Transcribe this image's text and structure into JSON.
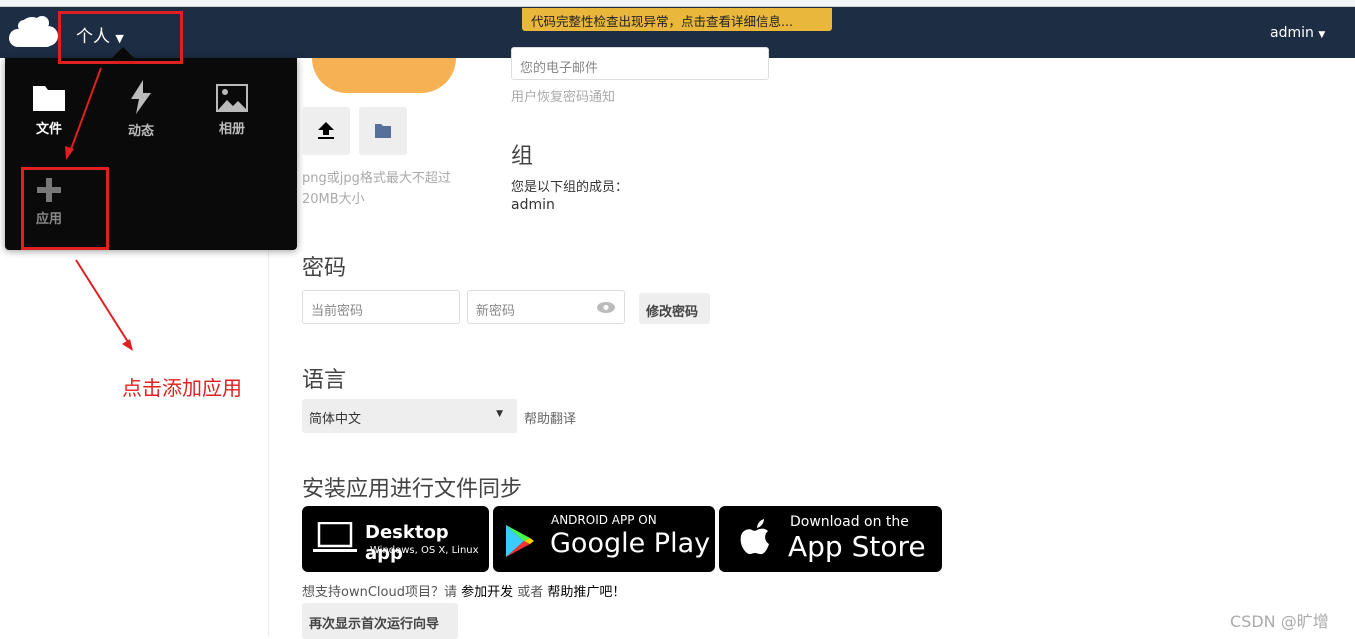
{
  "header": {
    "menu_label": "个人",
    "warning": "代码完整性检查出现异常，点击查看详细信息...",
    "user": "admin"
  },
  "apps_menu": [
    {
      "label": "文件",
      "icon": "folder-icon"
    },
    {
      "label": "动态",
      "icon": "lightning-icon"
    },
    {
      "label": "相册",
      "icon": "image-icon"
    },
    {
      "label": "应用",
      "icon": "plus-icon"
    }
  ],
  "avatar": {
    "hint": "png或jpg格式最大不超过20MB大小"
  },
  "email": {
    "placeholder": "您的电子邮件",
    "hint": "用户恢复密码通知"
  },
  "groups": {
    "title": "组",
    "desc": "您是以下组的成员：",
    "value": "admin"
  },
  "password": {
    "title": "密码",
    "current_placeholder": "当前密码",
    "new_placeholder": "新密码",
    "button": "修改密码"
  },
  "language": {
    "title": "语言",
    "selected": "简体中文",
    "help": "帮助翻译"
  },
  "sync": {
    "title": "安装应用进行文件同步",
    "desktop": {
      "title": "Desktop app",
      "sub": "Windows, OS X, Linux"
    },
    "android": {
      "top": "ANDROID APP ON",
      "main": "Google Play"
    },
    "ios": {
      "top": "Download on the",
      "main": "App Store"
    },
    "support_prefix": "想支持ownCloud项目？请 ",
    "support_link1": "参加开发",
    "support_mid": " 或者 ",
    "support_link2": "帮助推广吧！",
    "wizard_button": "再次显示首次运行向导"
  },
  "annotation": "点击添加应用",
  "watermark": "CSDN @旷增",
  "colors": {
    "header": "#1d2d44",
    "warning": "#e9b73b",
    "avatar": "#f5b152",
    "annotation": "#e02020"
  }
}
